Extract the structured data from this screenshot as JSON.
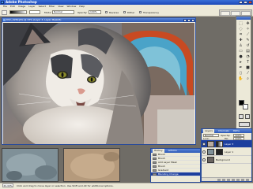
{
  "app": {
    "title": "Adobe Photoshop"
  },
  "menus": [
    "File",
    "Edit",
    "Image",
    "Layer",
    "Select",
    "Filter",
    "View",
    "Window",
    "Help"
  ],
  "options": {
    "mode_label": "Mode:",
    "mode_value": "Normal",
    "opacity_label": "Opacity:",
    "opacity_value": "100%",
    "reverse_label": "Reverse",
    "dither_label": "Dither",
    "transparency_label": "Transparency"
  },
  "document": {
    "title": "DSC_0250.JPG @ 33% (Layer 3, Layer Mask/8)"
  },
  "status": {
    "zoom": "33.33%",
    "hint": "Click and drag to move layer or selection. Use Shift and Alt for additional options."
  },
  "history": {
    "tabs": [
      "History",
      "Actions"
    ],
    "items": [
      "Brush",
      "Brush",
      "Add Layer Mask",
      "Brush",
      "Gradient",
      "Blending Change"
    ],
    "active_index": 5
  },
  "layers": {
    "tabs": [
      "Layers",
      "Channels",
      "Paths"
    ],
    "blend_mode": "Normal",
    "opacity_label": "Opacity:",
    "opacity_value": "100%",
    "fill_label": "Fill:",
    "fill_value": "100%",
    "lock_label": "Lock:",
    "items": [
      {
        "name": "Layer 3",
        "active": true
      },
      {
        "name": "Layer 1",
        "active": false
      },
      {
        "name": "Background",
        "active": false
      }
    ]
  },
  "colors": {
    "titlebar": "#1b48b8",
    "chrome": "#ece9d8",
    "selection": "#1c3e9e",
    "foreground_swatch": "#000000",
    "background_swatch": "#ffffff"
  }
}
